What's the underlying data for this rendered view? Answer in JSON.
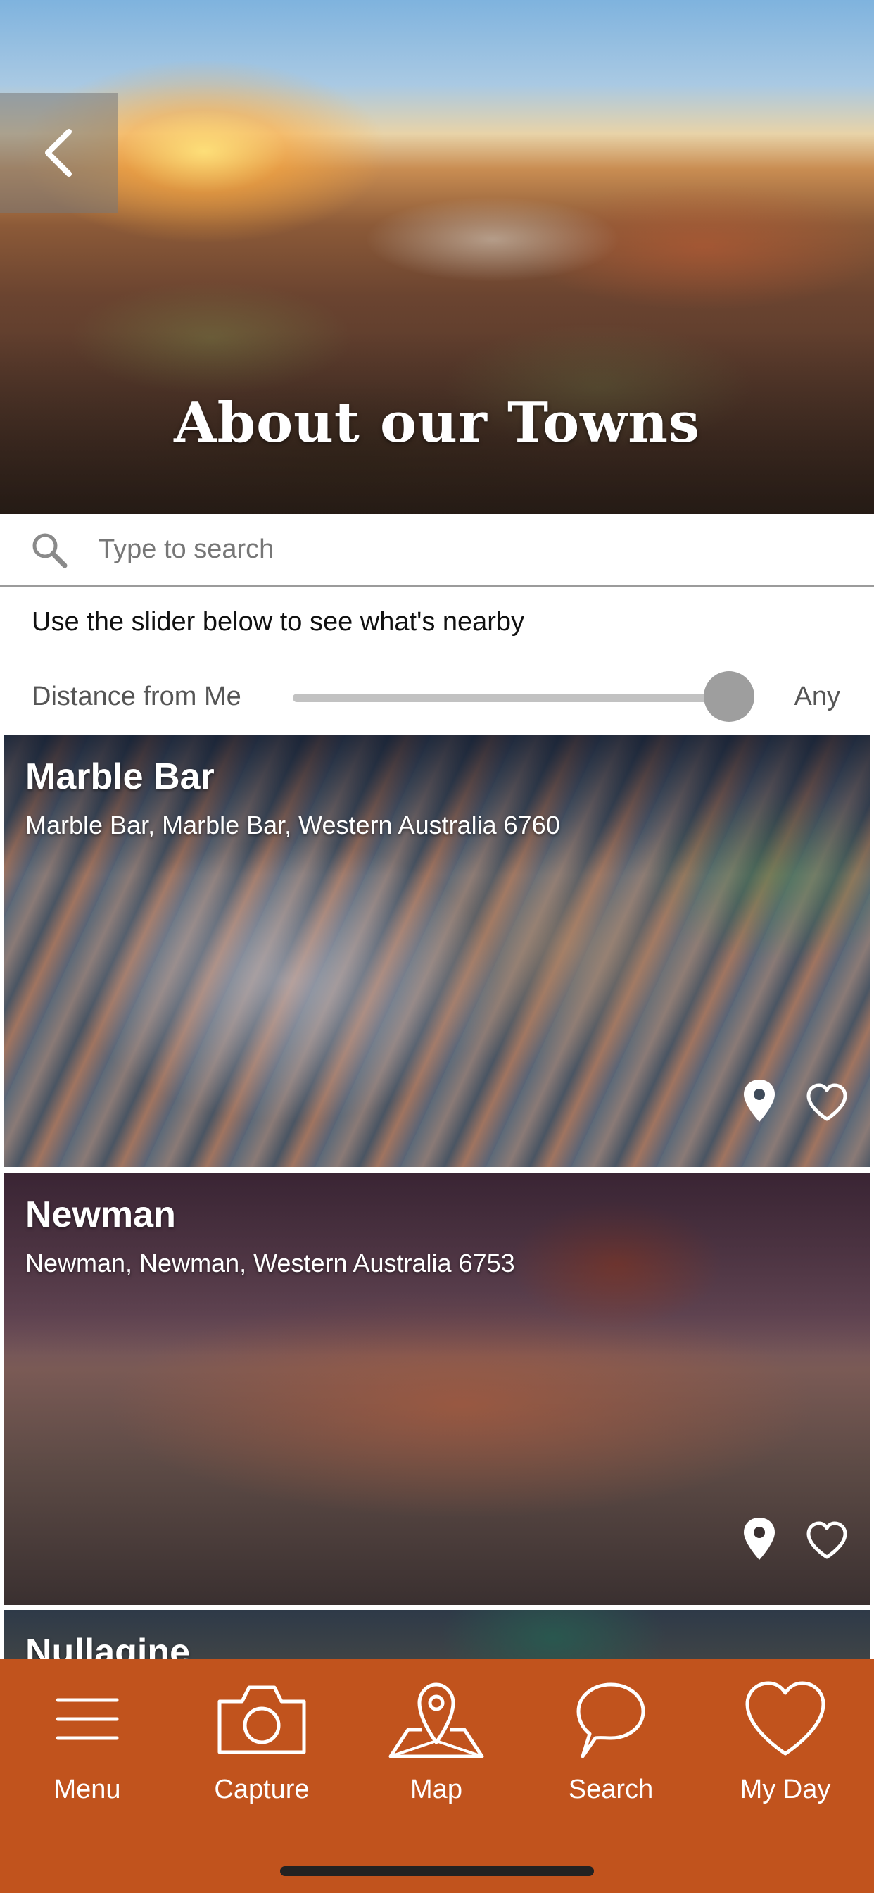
{
  "header": {
    "title": "About our Towns",
    "back_icon": "chevron-left-icon"
  },
  "search": {
    "placeholder": "Type to search",
    "value": "",
    "icon": "search-icon"
  },
  "hint_text": "Use the slider below to see what's nearby",
  "distance_filter": {
    "label": "Distance from Me",
    "value_label": "Any",
    "level": 1.0
  },
  "towns": [
    {
      "name": "Marble Bar",
      "address": "Marble Bar, Marble Bar, Western Australia 6760"
    },
    {
      "name": "Newman",
      "address": "Newman, Newman, Western Australia 6753"
    },
    {
      "name": "Nullagine",
      "address": ""
    }
  ],
  "bottom_nav": {
    "items": [
      {
        "label": "Menu",
        "icon": "hamburger-menu-icon"
      },
      {
        "label": "Capture",
        "icon": "camera-icon"
      },
      {
        "label": "Map",
        "icon": "map-pin-icon"
      },
      {
        "label": "Search",
        "icon": "speech-bubble-icon"
      },
      {
        "label": "My Day",
        "icon": "heart-icon"
      }
    ]
  },
  "colors": {
    "nav_background": "#c1531d",
    "slider_track": "#c2c2c2",
    "slider_thumb": "#9e9e9e"
  }
}
